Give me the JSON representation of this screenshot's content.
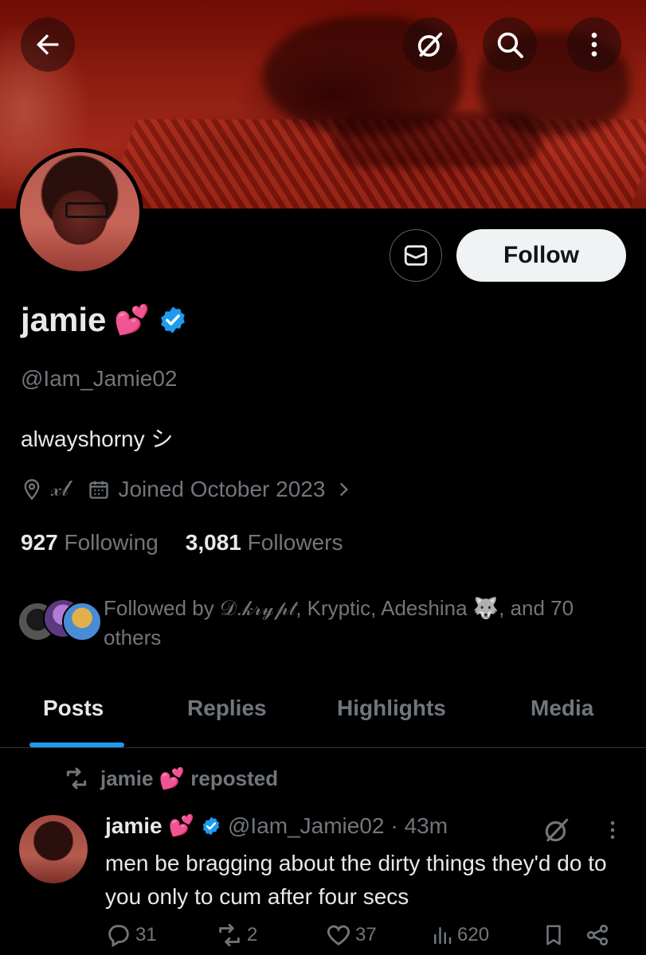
{
  "profile": {
    "name": "jamie",
    "name_emoji": "💕",
    "handle": "@Iam_Jamie02",
    "bio": "alwayshorny シ",
    "location": "𝓍𝓁",
    "joined": "Joined October 2023",
    "following_count": "927",
    "following_label": "Following",
    "followers_count": "3,081",
    "followers_label": "Followers",
    "followed_by_text": "Followed by 𝒟.𝓀𝓇𝓎𝓅𝓉, Kryptic, Adeshina 🐺, and 70 others"
  },
  "header": {
    "back_icon": "arrow-left-icon",
    "grok_icon": "grok-icon",
    "search_icon": "search-icon",
    "more_icon": "more-vertical-icon"
  },
  "actions": {
    "message_icon": "mail-icon",
    "follow_label": "Follow"
  },
  "tabs": [
    {
      "label": "Posts",
      "active": true
    },
    {
      "label": "Replies",
      "active": false
    },
    {
      "label": "Highlights",
      "active": false
    },
    {
      "label": "Media",
      "active": false
    }
  ],
  "post": {
    "repost_label": "jamie 💕 reposted",
    "author_name": "jamie",
    "author_emoji": "💕",
    "author_handle": "@Iam_Jamie02",
    "time": "· 43m",
    "text": "men be bragging about the dirty things they'd do to you only to cum after four secs",
    "replies": "31",
    "reposts": "2",
    "likes": "37",
    "views": "620"
  },
  "colors": {
    "background": "#000000",
    "text_primary": "#e7e9ea",
    "text_secondary": "#71767b",
    "accent": "#1d9bf0",
    "follow_button_bg": "#eff3f4"
  }
}
